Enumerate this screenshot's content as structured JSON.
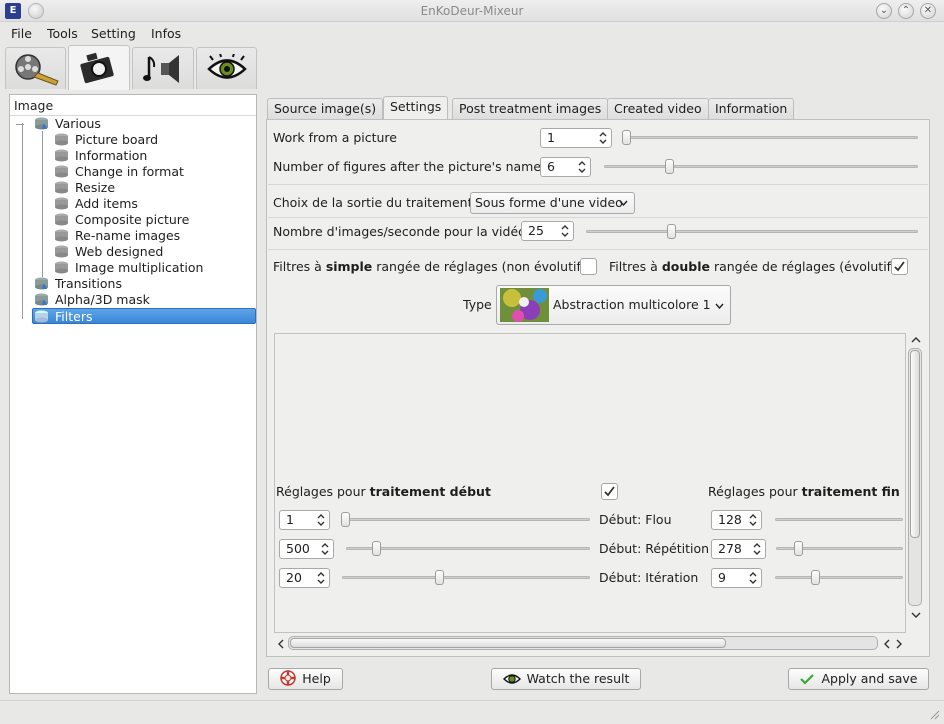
{
  "window": {
    "title": "EnKoDeur-Mixeur"
  },
  "menu": {
    "items": [
      "File",
      "Tools",
      "Setting",
      "Infos"
    ]
  },
  "toolbar_tabs": [
    "film-reel-icon",
    "camera-icon",
    "music-speaker-icon",
    "eye-icon"
  ],
  "tree": {
    "header": "Image",
    "items": [
      {
        "label": "Various",
        "level": 0
      },
      {
        "label": "Picture board",
        "level": 1
      },
      {
        "label": "Information",
        "level": 1
      },
      {
        "label": "Change in format",
        "level": 1
      },
      {
        "label": "Resize",
        "level": 1
      },
      {
        "label": "Add items",
        "level": 1
      },
      {
        "label": "Composite picture",
        "level": 1
      },
      {
        "label": "Re-name images",
        "level": 1
      },
      {
        "label": "Web designed",
        "level": 1
      },
      {
        "label": "Image multiplication",
        "level": 1
      },
      {
        "label": "Transitions",
        "level": 0
      },
      {
        "label": "Alpha/3D mask",
        "level": 0
      },
      {
        "label": "Filters",
        "level": 0,
        "selected": true
      }
    ]
  },
  "tabs": [
    "Source image(s)",
    "Settings",
    "Post treatment images",
    "Created video",
    "Information"
  ],
  "settings": {
    "work_from_picture": {
      "label": "Work from a picture",
      "value": "1",
      "slider_fraction": 0.0
    },
    "figures_after_name": {
      "label": "Number of figures after the picture's name",
      "value": "6",
      "slider_fraction": 0.2
    },
    "output_choice": {
      "label": "Choix de la sortie du traitement",
      "value": "Sous forme d'une video"
    },
    "fps": {
      "label": "Nombre d'images/seconde pour la vidéo",
      "value": "25",
      "slider_fraction": 0.25
    },
    "simple_filter": {
      "prefix": "Filtres à ",
      "bold": "simple",
      "suffix": " rangée de réglages (non évolutif)",
      "checked": false
    },
    "double_filter": {
      "prefix": "Filtres à ",
      "bold": "double",
      "suffix": " rangée de réglages (évolutif)",
      "checked": true
    },
    "type": {
      "label": "Type",
      "value": "Abstraction multicolore 1"
    }
  },
  "adjust": {
    "start_prefix": "Réglages pour ",
    "start_bold": "traitement début",
    "end_prefix": "Réglages pour ",
    "end_bold": "traitement fin",
    "start_checked": true,
    "rows": [
      {
        "start_value": "1",
        "label": "Début: Flou",
        "end_value": "128",
        "start_fraction": 0.0,
        "end_fraction": null
      },
      {
        "start_value": "500",
        "label": "Début: Répétition",
        "end_value": "278",
        "start_fraction": 0.11,
        "end_fraction": 0.15
      },
      {
        "start_value": "20",
        "label": "Début: Itération",
        "end_value": "9",
        "start_fraction": 0.39,
        "end_fraction": 0.3
      }
    ]
  },
  "buttons": {
    "help": "Help",
    "watch": "Watch the result",
    "apply": "Apply and save"
  }
}
